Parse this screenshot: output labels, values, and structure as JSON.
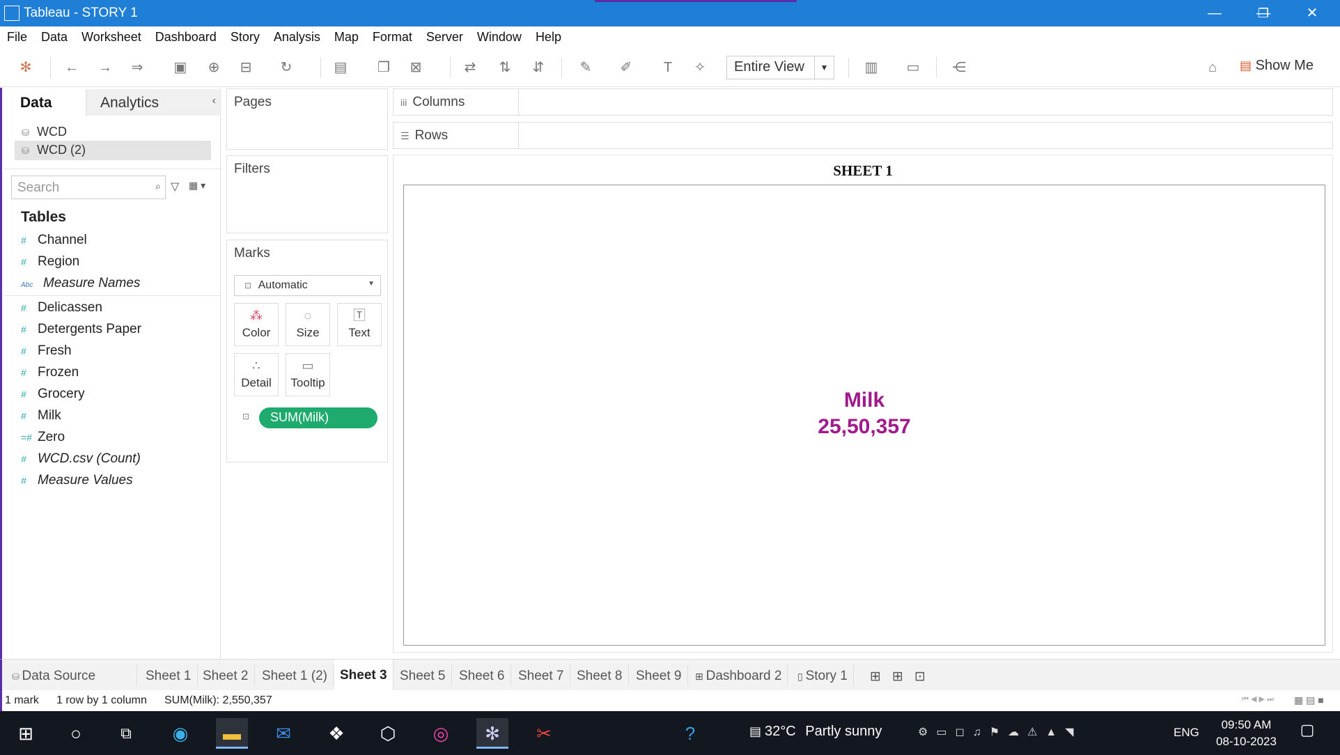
{
  "window": {
    "title": "Tableau - STORY 1",
    "minimize": "—",
    "restore": "❐",
    "close": "✕"
  },
  "menu": [
    "File",
    "Data",
    "Worksheet",
    "Dashboard",
    "Story",
    "Analysis",
    "Map",
    "Format",
    "Server",
    "Window",
    "Help"
  ],
  "toolbar": {
    "view_mode": "Entire View",
    "show_me": "Show Me"
  },
  "data_pane": {
    "tab_data": "Data",
    "tab_analytics": "Analytics",
    "datasources": [
      "WCD",
      "WCD (2)"
    ],
    "search_placeholder": "Search",
    "tables_header": "Tables",
    "fields": [
      {
        "name": "Channel",
        "italic": false,
        "type": "#"
      },
      {
        "name": "Region",
        "italic": false,
        "type": "#"
      },
      {
        "name": "Measure Names",
        "italic": true,
        "type": "Abc"
      },
      {
        "name": "Delicassen",
        "italic": false,
        "type": "#"
      },
      {
        "name": "Detergents Paper",
        "italic": false,
        "type": "#"
      },
      {
        "name": "Fresh",
        "italic": false,
        "type": "#"
      },
      {
        "name": "Frozen",
        "italic": false,
        "type": "#"
      },
      {
        "name": "Grocery",
        "italic": false,
        "type": "#"
      },
      {
        "name": "Milk",
        "italic": false,
        "type": "#"
      },
      {
        "name": "Zero",
        "italic": false,
        "type": "=#"
      },
      {
        "name": "WCD.csv (Count)",
        "italic": true,
        "type": "#"
      },
      {
        "name": "Measure Values",
        "italic": true,
        "type": "#"
      }
    ]
  },
  "cards": {
    "pages": "Pages",
    "filters": "Filters",
    "marks": "Marks",
    "mark_type": "Automatic",
    "mark_buttons": [
      "Color",
      "Size",
      "Text",
      "Detail",
      "Tooltip"
    ],
    "pill": "SUM(Milk)"
  },
  "shelves": {
    "columns": "Columns",
    "rows": "Rows"
  },
  "viz": {
    "sheet_title": "SHEET 1",
    "label": "Milk",
    "value": "25,50,357"
  },
  "sheet_tabs": [
    "Data Source",
    "Sheet 1",
    "Sheet 2",
    "Sheet 1 (2)",
    "Sheet 3",
    "Sheet 5",
    "Sheet 6",
    "Sheet 7",
    "Sheet 8",
    "Sheet 9",
    "Dashboard 2",
    "Story 1"
  ],
  "active_tab": "Sheet 3",
  "status": {
    "marks": "1 mark",
    "dims": "1 row by 1 column",
    "sum": "SUM(Milk): 2,550,357"
  },
  "taskbar": {
    "temp": "32°C",
    "weather": "Partly sunny",
    "lang": "ENG",
    "time": "09:50 AM",
    "date": "08-10-2023"
  }
}
